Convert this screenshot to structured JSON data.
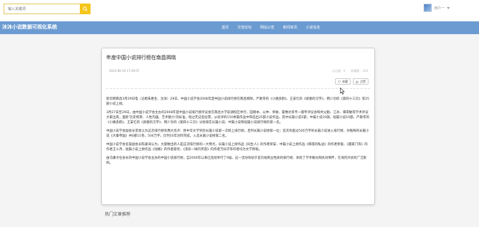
{
  "search": {
    "placeholder": "输入关键词"
  },
  "user": {
    "name": "用户一"
  },
  "site": {
    "brand": "沐沐小说数据可视化系统"
  },
  "nav": {
    "items": [
      "首页",
      "交流论坛",
      "网站公告",
      "新闻资讯",
      "小说信息"
    ]
  },
  "article": {
    "title": "年度中国小说排行榜在南昌揭晓",
    "date": "2024-08-19 17:39:07",
    "clicks": "点击量：0",
    "favorites": "收藏数：208",
    "favorite_label": "收藏",
    "like_label": "点赞",
    "paragraphs": [
      "新华网南昌3月29日电（记者朱春生、沈洋）29日，中国小说学会2008年度中国小说排行榜在南昌揭晓，严歌苓的《小姨多鹤》、王安忆的《骄傲的汉字》、韩少功的《第四十三页》等25部小说上榜。",
      "3月27日至29日，由中国小说学会主办的2008年度中国小说排行榜评议会在南昌大学前湖校区举行，田刚本、公仲、孝敏、雷惠达等专一都专评议会和共父勤、江冰、谭得敏等学术评议大家出席，面新‘历史积厚、人性内蕴、艺术魅力’的标准，经过无记名投票，从初评的150余篇作品中筛选出25部小说作品，其中长篇小说5部，中篇小说10部，短篇小说10部。严歌苓的《小姨多鹤》、王安忆的《骄傲的汉字》、韩少功的《第四十三页》分别排在长篇小说、中篇小说和短篇小说排行榜的第一名。",
      "中国小说学会副会长李星认为这次排行榜有两大亮点：原中华文学奖的长篇小说第一次跃上排行榜，且列长篇小说榜第一位；首次有超过500万字的长篇小说进入排行榜，孙皓晖的长篇小说《大秦帝国》共6部11卷，504万字，历时16年创作完成，入选长篇小说榜第二名。",
      "中国小说学会名誉副会长陈骏涛认为，大部数出新人是这次排行榜的一大特点，长篇小说上榜作品《同生人》的作者荣安、中篇小说上榜作品《那夜的私战》的作者郭俊、《圆家门等》的作者王十月、短篇小说上榜作品《闯阁》的作者薛亮、《漆彩一样的笑容》的作者万旧子等作者均为文学新锐。",
      "由马康才任会长的中国小说学会主办的中国小说排行榜，自2000年以来已连续举行了9届，这一活动有助于首页规则业性质的排行榜，体现了学术眼光和民间情怀，在海内外具有广泛影响。"
    ]
  },
  "hot": {
    "title": "热门文章推荐"
  },
  "colors": {
    "navbar": "#6b9bd1",
    "search_button": "#f5c518"
  }
}
